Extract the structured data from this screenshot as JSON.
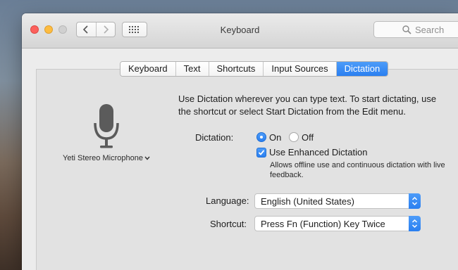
{
  "window": {
    "title": "Keyboard"
  },
  "toolbar": {
    "back_icon": "chevron-left-icon",
    "forward_icon": "chevron-right-icon",
    "grid_icon": "show-all-grid-icon",
    "search_placeholder": "Search"
  },
  "tabs": [
    {
      "label": "Keyboard",
      "active": false
    },
    {
      "label": "Text",
      "active": false
    },
    {
      "label": "Shortcuts",
      "active": false
    },
    {
      "label": "Input Sources",
      "active": false
    },
    {
      "label": "Dictation",
      "active": true
    }
  ],
  "microphone": {
    "label": "Yeti Stereo Microphone"
  },
  "description": "Use Dictation wherever you can type text. To start dictating, use the shortcut or select Start Dictation from the Edit menu.",
  "dictation": {
    "label": "Dictation:",
    "on_label": "On",
    "off_label": "Off",
    "selected": "On"
  },
  "enhanced": {
    "checked": true,
    "label": "Use Enhanced Dictation",
    "note": "Allows offline use and continuous dictation with live feedback."
  },
  "language": {
    "label": "Language:",
    "value": "English (United States)"
  },
  "shortcut": {
    "label": "Shortcut:",
    "value": "Press Fn (Function) Key Twice"
  },
  "colors": {
    "accent": "#2a7ff0",
    "close": "#fc605c",
    "minimize": "#fdbc40"
  }
}
